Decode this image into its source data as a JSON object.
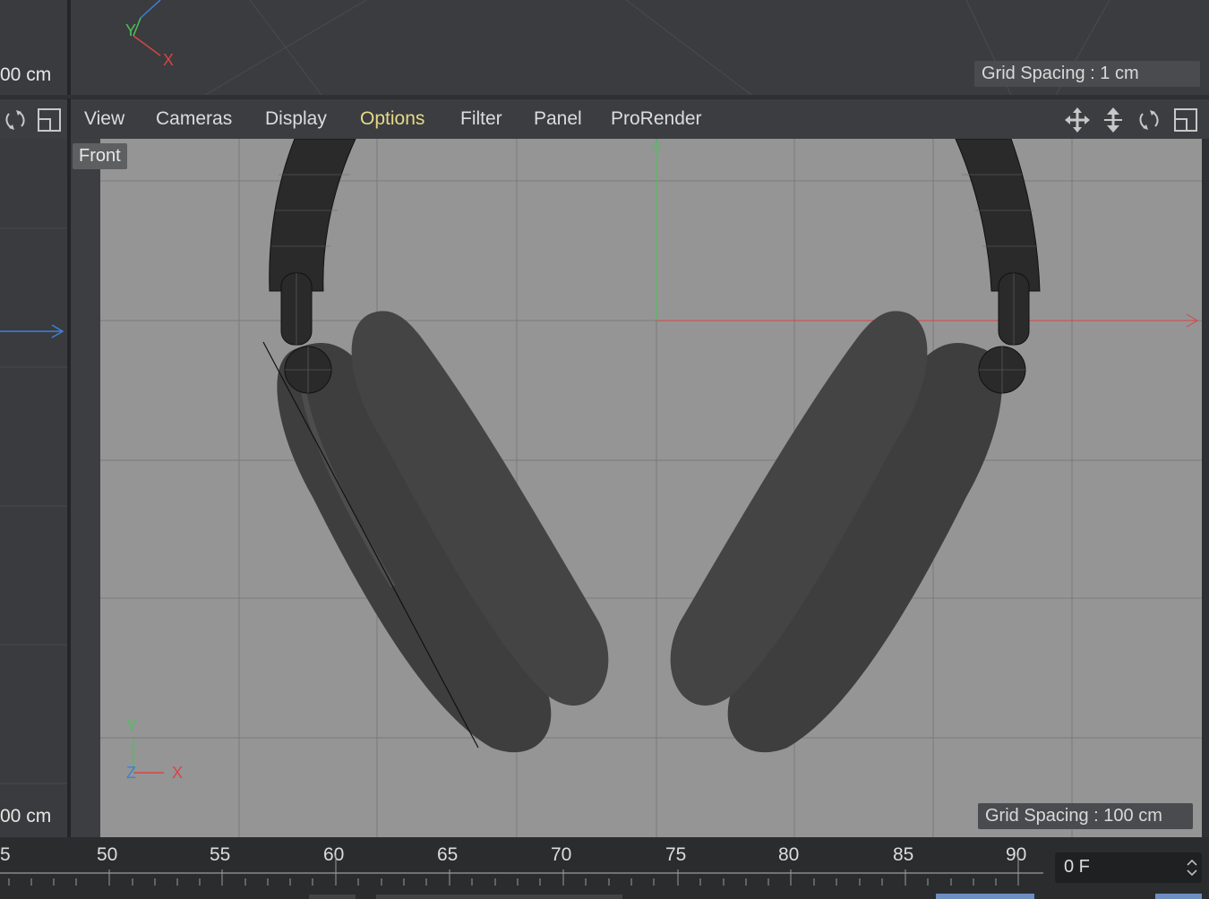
{
  "top_viewport": {
    "cm_label": "00 cm",
    "grid_spacing": "Grid Spacing : 1 cm",
    "axis_labels": {
      "y": "Y",
      "x": "X"
    }
  },
  "menu": {
    "items": [
      {
        "label": "View",
        "active": false
      },
      {
        "label": "Cameras",
        "active": false
      },
      {
        "label": "Display",
        "active": false
      },
      {
        "label": "Options",
        "active": true
      },
      {
        "label": "Filter",
        "active": false
      },
      {
        "label": "Panel",
        "active": false
      },
      {
        "label": "ProRender",
        "active": false
      }
    ],
    "tool_icons": [
      "move-icon",
      "zoom-icon",
      "rotate-icon",
      "maximize-icon"
    ]
  },
  "left_panel": {
    "cm_label": "00 cm"
  },
  "front_viewport": {
    "label": "Front",
    "grid_spacing": "Grid Spacing : 100 cm",
    "axis_labels": {
      "y": "Y",
      "z": "Z",
      "x": "X"
    }
  },
  "timeline": {
    "tick_labels": [
      "5",
      "50",
      "55",
      "60",
      "65",
      "70",
      "75",
      "80",
      "85",
      "90"
    ],
    "current_frame": "0 F"
  },
  "colors": {
    "active_menu": "#e6d98a",
    "axis_x": "#d64545",
    "axis_y": "#4fbf5a",
    "axis_z": "#3f7fd9"
  }
}
